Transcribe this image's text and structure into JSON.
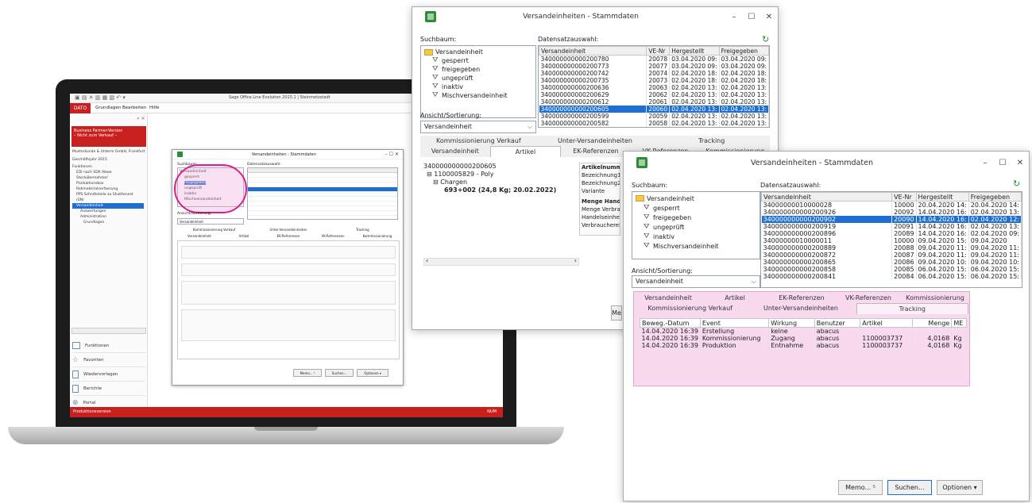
{
  "laptop": {
    "app_title": "Sage Office Line Evolution 2015.1 | Steinmetzstadt",
    "menu": [
      "DATO",
      "Grundlagen",
      "Bearbeiten",
      "Hilfe"
    ],
    "banner_line1": "Business Partner-Version",
    "banner_line2": "– Nicht zum Verkauf –",
    "company_line": "Musterkunde & Unterm GmbH, Frankfurt",
    "year": "Geschäftsjahr 2015",
    "nav_items": [
      "Funktionen",
      "EDI nach SDK Abwe",
      "Stockübernahme/",
      "Produktionsbox",
      "Rohmaterialverfassung",
      "PPS Schnittstelle zu Shuttlenest",
      "(SN)",
      "Versandeinheit",
      "Auswertungen",
      "Administration",
      "Grundlagen"
    ],
    "bottom_nav": [
      "Funktionen",
      "Favoriten",
      "Wiedervorlagen",
      "Berichte",
      "Portal"
    ],
    "status_bar": "Produktionsversion",
    "status_right": "NUM",
    "inner_title": "Versandeinheiten - Stammdaten",
    "inner_tree": [
      "Versandeinheit",
      "gesperrt",
      "freigegeben",
      "ungeprüft",
      "inaktiv",
      "Mischversandeinheit"
    ],
    "inner_label_suchbaum": "Suchbaum:",
    "inner_label_datensatz": "Datensatzauswahl:",
    "inner_label_sort": "Ansicht/Sortierung:",
    "inner_sort_value": "Versandeinheit",
    "inner_tabs1": [
      "Kommissionierung Verkauf",
      "Unter-Versandeinheiten",
      "Tracking"
    ],
    "inner_tabs2": [
      "Versandeinheit",
      "Artikel",
      "EK-Referenzen",
      "VK-Referenzen",
      "Kommissionierung"
    ],
    "inner_buttons": [
      "Memo... ⁵",
      "Suchen...",
      "Optionen ▾"
    ]
  },
  "window_mid": {
    "title": "Versandeinheiten - Stammdaten",
    "label_suchbaum": "Suchbaum:",
    "label_datensatz": "Datensatzauswahl:",
    "tree": [
      "Versandeinheit",
      "gesperrt",
      "freigegeben",
      "ungeprüft",
      "inaktiv",
      "Mischversandeinheit"
    ],
    "columns": [
      "Versandeinheit",
      "VE-Nr",
      "Hergestellt",
      "Freigegeben"
    ],
    "rows": [
      [
        "340000000000200780",
        "20078",
        "03.04.2020 09:",
        "03.04.2020 09:"
      ],
      [
        "340000000000200773",
        "20077",
        "03.04.2020 09:",
        "03.04.2020 09:"
      ],
      [
        "340000000000200742",
        "20074",
        "02.04.2020 18:",
        "02.04.2020 18:"
      ],
      [
        "340000000000200735",
        "20073",
        "02.04.2020 18:",
        "02.04.2020 18:"
      ],
      [
        "340000000000200636",
        "20063",
        "02.04.2020 13:",
        "02.04.2020 13:"
      ],
      [
        "340000000000200629",
        "20062",
        "02.04.2020 13:",
        "02.04.2020 13:"
      ],
      [
        "340000000000200612",
        "20061",
        "02.04.2020 13:",
        "02.04.2020 13:"
      ],
      [
        "340000000000200605",
        "20060",
        "02.04.2020 13:",
        "02.04.2020 13:"
      ],
      [
        "340000000000200599",
        "20059",
        "02.04.2020 13:",
        "02.04.2020 13:"
      ],
      [
        "340000000000200582",
        "20058",
        "02.04.2020 13:",
        "02.04.2020 13:"
      ]
    ],
    "label_sort": "Ansicht/Sortierung:",
    "sort_value": "Versandeinheit",
    "tabs_row1": [
      "Kommissionierung Verkauf",
      "Unter-Versandeinheiten",
      "Tracking"
    ],
    "tabs_row2": [
      "Versandeinheit",
      "Artikel",
      "EK-Referenzen",
      "VK-Referenzen",
      "Kommissionierung"
    ],
    "active_tab": "Artikel",
    "detail_tree": [
      "340000000000200605",
      "1100005829 - Poly",
      "Chargen",
      "693+002 (24,8 Kg; 20.02.2022)"
    ],
    "detail_fields": [
      "Artikelnummer",
      "Bezeichnung1",
      "Bezeichnung2",
      "Variante",
      "Menge Handelse",
      "Menge Verbrauc",
      "Handelseinheit e",
      "Verbrauchereinh"
    ],
    "cut_button": "Me"
  },
  "window_front": {
    "title": "Versandeinheiten - Stammdaten",
    "label_suchbaum": "Suchbaum:",
    "label_datensatz": "Datensatzauswahl:",
    "tree": [
      "Versandeinheit",
      "gesperrt",
      "freigegeben",
      "ungeprüft",
      "inaktiv",
      "Mischversandeinheit"
    ],
    "columns": [
      "Versandeinheit",
      "VE-Nr",
      "Hergestellt",
      "Freigegeben"
    ],
    "rows": [
      [
        "34000000010000028",
        "10000",
        "20.04.2020 14:",
        "20.04.2020 14:"
      ],
      [
        "340000000000200926",
        "20092",
        "14.04.2020 16:",
        "02.04.2020 13:"
      ],
      [
        "340000000000200902",
        "20090",
        "14.04.2020 16:",
        "02.04.2020 12:"
      ],
      [
        "340000000000200919",
        "20091",
        "14.04.2020 16:",
        "02.04.2020 13:"
      ],
      [
        "340000000000200896",
        "20089",
        "14.04.2020 16:",
        "02.04.2020 09:"
      ],
      [
        "34000000010000011",
        "10000",
        "09.04.2020 15:",
        "09.04.2020"
      ],
      [
        "340000000000200889",
        "20088",
        "09.04.2020 11:",
        "09.04.2020 11:"
      ],
      [
        "340000000000200872",
        "20087",
        "09.04.2020 11:",
        "09.04.2020 11:"
      ],
      [
        "340000000000200865",
        "20086",
        "09.04.2020 10:",
        "09.04.2020 10:"
      ],
      [
        "340000000000200858",
        "20085",
        "06.04.2020 15:",
        "06.04.2020 15:"
      ],
      [
        "340000000000200841",
        "20084",
        "06.04.2020 15:",
        "06.04.2020 15:"
      ]
    ],
    "label_sort": "Ansicht/Sortierung:",
    "sort_value": "Versandeinheit",
    "tabs_row1": [
      "Versandeinheit",
      "Artikel",
      "EK-Referenzen",
      "VK-Referenzen",
      "Kommissionierung"
    ],
    "tabs_row2": [
      "Kommissionierung Verkauf",
      "Unter-Versandeinheiten",
      "Tracking"
    ],
    "active_tab": "Tracking",
    "tracking_columns": [
      "Beweg.-Datum",
      "Event",
      "Wirkung",
      "Benutzer",
      "Artikel",
      "Menge",
      "ME"
    ],
    "tracking_rows": [
      [
        "14.04.2020 16:39",
        "Erstellung",
        "keine",
        "abacus",
        "",
        "",
        ""
      ],
      [
        "14.04.2020 16:39",
        "Kommissionierung",
        "Zugang",
        "abacus",
        "1100003737",
        "4,0168",
        "Kg"
      ],
      [
        "14.04.2020 16:39",
        "Produktion",
        "Entnahme",
        "abacus",
        "1100003737",
        "4,0168",
        "Kg"
      ]
    ],
    "btn_memo": "Memo... ⁵",
    "btn_suchen": "Suchen...",
    "btn_optionen": "Optionen ▾"
  },
  "colors": {
    "accent_red": "#c8201e",
    "selection_blue": "#1e6fd1",
    "highlight_pink": "#e7a3cf"
  }
}
